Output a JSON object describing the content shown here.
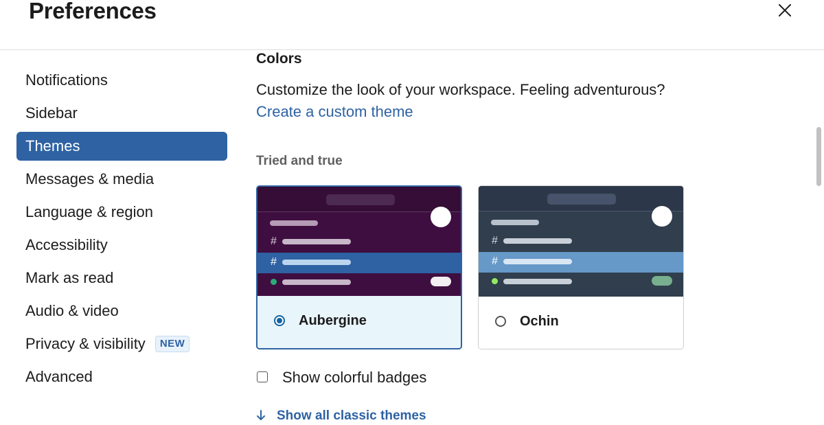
{
  "header": {
    "title": "Preferences",
    "close_icon": "close-icon"
  },
  "sidebar": {
    "items": [
      {
        "label": "Notifications"
      },
      {
        "label": "Sidebar"
      },
      {
        "label": "Themes"
      },
      {
        "label": "Messages & media"
      },
      {
        "label": "Language & region"
      },
      {
        "label": "Accessibility"
      },
      {
        "label": "Mark as read"
      },
      {
        "label": "Audio & video"
      },
      {
        "label": "Privacy & visibility",
        "badge": "NEW"
      },
      {
        "label": "Advanced"
      }
    ],
    "active_label": "Themes"
  },
  "main": {
    "section_title": "Colors",
    "description": "Customize the look of your workspace. Feeling adventurous?",
    "custom_theme_link": "Create a custom theme",
    "group_label": "Tried and true",
    "themes": [
      {
        "name": "Aubergine",
        "selected": true,
        "sidebar_color": "#3f0e40",
        "highlight_color": "#2e62a3"
      },
      {
        "name": "Ochin",
        "selected": false,
        "sidebar_color": "#303e4d",
        "highlight_color": "#6698c8"
      }
    ],
    "show_colorful_badges_label": "Show colorful badges",
    "show_colorful_badges_checked": false,
    "show_classic_themes_label": "Show all classic themes",
    "show_classic_themes_icon": "arrow-down-icon"
  },
  "colors": {
    "accent": "#2e62a3",
    "text": "#1d1c1d",
    "muted": "#616061"
  }
}
